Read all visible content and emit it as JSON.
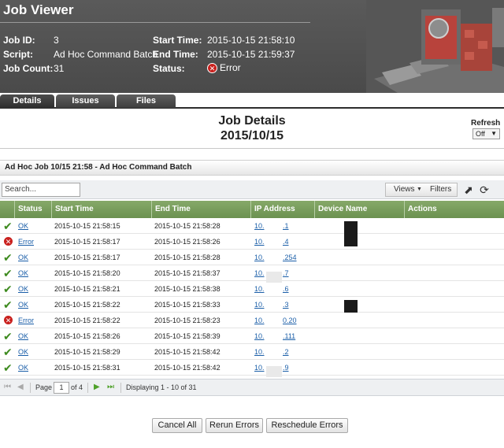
{
  "header": {
    "title": "Job Viewer",
    "job_id_label": "Job ID:",
    "job_id": "3",
    "script_label": "Script:",
    "script": "Ad Hoc Command Batch",
    "job_count_label": "Job Count:",
    "job_count": "31",
    "start_time_label": "Start Time:",
    "start_time": "2015-10-15 21:58:10",
    "end_time_label": "End Time:",
    "end_time": "2015-10-15 21:59:37",
    "status_label": "Status:",
    "status": "Error"
  },
  "tabs": [
    {
      "label": "Details",
      "active": true
    },
    {
      "label": "Issues",
      "active": false
    },
    {
      "label": "Files",
      "active": false
    }
  ],
  "details": {
    "title": "Job Details",
    "date": "2015/10/15",
    "refresh_label": "Refresh",
    "refresh_value": "Off"
  },
  "panel": {
    "title": "Ad Hoc Job 10/15 21:58 - Ad Hoc Command Batch",
    "search_placeholder": "Search...",
    "views_label": "Views",
    "filters_label": "Filters"
  },
  "grid": {
    "columns": [
      "Status",
      "Start Time",
      "End Time",
      "IP Address",
      "Device Name",
      "Actions"
    ],
    "rows": [
      {
        "status": "OK",
        "start": "2015-10-15 21:58:15",
        "end": "2015-10-15 21:58:28",
        "ip_a": "10.",
        "ip_b": ".1"
      },
      {
        "status": "Error",
        "start": "2015-10-15 21:58:17",
        "end": "2015-10-15 21:58:26",
        "ip_a": "10.",
        "ip_b": ".4"
      },
      {
        "status": "OK",
        "start": "2015-10-15 21:58:17",
        "end": "2015-10-15 21:58:28",
        "ip_a": "10.",
        "ip_b": ".254"
      },
      {
        "status": "OK",
        "start": "2015-10-15 21:58:20",
        "end": "2015-10-15 21:58:37",
        "ip_a": "10.",
        "ip_b": ".7"
      },
      {
        "status": "OK",
        "start": "2015-10-15 21:58:21",
        "end": "2015-10-15 21:58:38",
        "ip_a": "10.",
        "ip_b": ".6"
      },
      {
        "status": "OK",
        "start": "2015-10-15 21:58:22",
        "end": "2015-10-15 21:58:33",
        "ip_a": "10.",
        "ip_b": ".3"
      },
      {
        "status": "Error",
        "start": "2015-10-15 21:58:22",
        "end": "2015-10-15 21:58:23",
        "ip_a": "10.",
        "ip_b": "0.20"
      },
      {
        "status": "OK",
        "start": "2015-10-15 21:58:26",
        "end": "2015-10-15 21:58:39",
        "ip_a": "10.",
        "ip_b": ".111"
      },
      {
        "status": "OK",
        "start": "2015-10-15 21:58:29",
        "end": "2015-10-15 21:58:42",
        "ip_a": "10.",
        "ip_b": ".2"
      },
      {
        "status": "OK",
        "start": "2015-10-15 21:58:31",
        "end": "2015-10-15 21:58:42",
        "ip_a": "10.",
        "ip_b": ".9"
      }
    ]
  },
  "pager": {
    "page_label": "Page",
    "page": "1",
    "of_label": "of 4",
    "displaying": "Displaying 1 - 10 of 31"
  },
  "buttons": {
    "cancel_all": "Cancel All",
    "rerun_errors": "Rerun Errors",
    "reschedule_errors": "Reschedule Errors"
  }
}
